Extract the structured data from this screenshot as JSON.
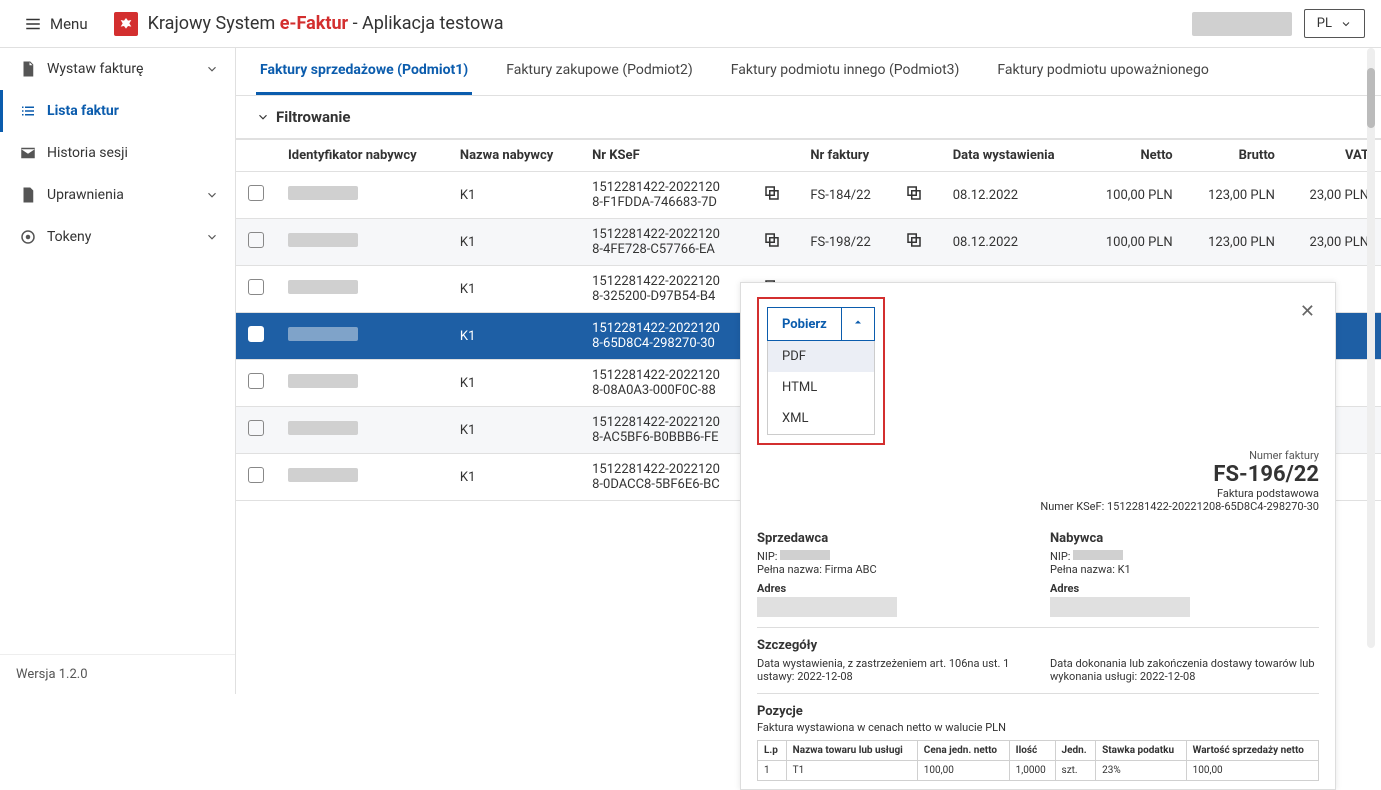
{
  "header": {
    "menu": "Menu",
    "title_prefix": "Krajowy System ",
    "title_brand_1": "e-",
    "title_brand_2": "Faktur",
    "title_suffix": " - Aplikacja testowa",
    "lang": "PL"
  },
  "sidebar": {
    "items": [
      {
        "label": "Wystaw fakturę",
        "icon": "doc"
      },
      {
        "label": "Lista faktur",
        "icon": "list",
        "active": true
      },
      {
        "label": "Historia sesji",
        "icon": "mail"
      },
      {
        "label": "Uprawnienia",
        "icon": "file"
      },
      {
        "label": "Tokeny",
        "icon": "circle"
      }
    ],
    "version": "Wersja 1.2.0"
  },
  "tabs": [
    {
      "label": "Faktury sprzedażowe (Podmiot1)",
      "active": true
    },
    {
      "label": "Faktury zakupowe (Podmiot2)"
    },
    {
      "label": "Faktury podmiotu innego (Podmiot3)"
    },
    {
      "label": "Faktury podmiotu upoważnionego"
    }
  ],
  "filter_label": "Filtrowanie",
  "table": {
    "headers": [
      "",
      "Identyfikator nabywcy",
      "Nazwa nabywcy",
      "Nr KSeF",
      "",
      "Nr faktury",
      "",
      "Data wystawienia",
      "Netto",
      "Brutto",
      "VAT"
    ],
    "rows": [
      {
        "buyer": "K1",
        "ksef_1": "1512281422-2022120",
        "ksef_2": "8-F1FDDA-746683-7D",
        "nr": "FS-184/22",
        "date": "08.12.2022",
        "netto": "100,00 PLN",
        "brutto": "123,00 PLN",
        "vat": "23,00 PLN"
      },
      {
        "buyer": "K1",
        "ksef_1": "1512281422-2022120",
        "ksef_2": "8-4FE728-C57766-EA",
        "nr": "FS-198/22",
        "date": "08.12.2022",
        "netto": "100,00 PLN",
        "brutto": "123,00 PLN",
        "vat": "23,00 PLN",
        "alt": true
      },
      {
        "buyer": "K1",
        "ksef_1": "1512281422-2022120",
        "ksef_2": "8-325200-D97B54-B4"
      },
      {
        "buyer": "K1",
        "ksef_1": "1512281422-2022120",
        "ksef_2": "8-65D8C4-298270-30",
        "sel": true
      },
      {
        "buyer": "K1",
        "ksef_1": "1512281422-2022120",
        "ksef_2": "8-08A0A3-000F0C-88"
      },
      {
        "buyer": "K1",
        "ksef_1": "1512281422-2022120",
        "ksef_2": "8-AC5BF6-B0BBB6-FE",
        "alt": true
      },
      {
        "buyer": "K1",
        "ksef_1": "1512281422-2022120",
        "ksef_2": "8-0DACC8-5BF6E6-BC"
      }
    ]
  },
  "panel": {
    "download": "Pobierz",
    "opts": [
      "PDF",
      "HTML",
      "XML"
    ],
    "numer_lbl": "Numer faktury",
    "numer": "FS-196/22",
    "type": "Faktura podstawowa",
    "ksef_lbl": "Numer KSeF: ",
    "ksef": "1512281422-20221208-65D8C4-298270-30",
    "seller_h": "Sprzedawca",
    "buyer_h": "Nabywca",
    "nip_lbl": "NIP: ",
    "name_lbl": "Pełna nazwa: ",
    "seller_name": "Firma ABC",
    "buyer_name": "K1",
    "addr_lbl": "Adres",
    "details_h": "Szczegóły",
    "details_l": "Data wystawienia, z zastrzeżeniem art. 106na ust. 1 ustawy: ",
    "details_l_val": "2022-12-08",
    "details_r": "Data dokonania lub zakończenia dostawy towarów lub wykonania usługi: ",
    "details_r_val": "2022-12-08",
    "pos_h": "Pozycje",
    "pos_note": "Faktura wystawiona w cenach netto w walucie PLN",
    "pos_headers": [
      "L.p",
      "Nazwa towaru lub usługi",
      "Cena jedn. netto",
      "Ilość",
      "Jedn.",
      "Stawka podatku",
      "Wartość sprzedaży netto"
    ],
    "pos_row": [
      "1",
      "T1",
      "100,00",
      "1,0000",
      "szt.",
      "23%",
      "100,00"
    ]
  }
}
